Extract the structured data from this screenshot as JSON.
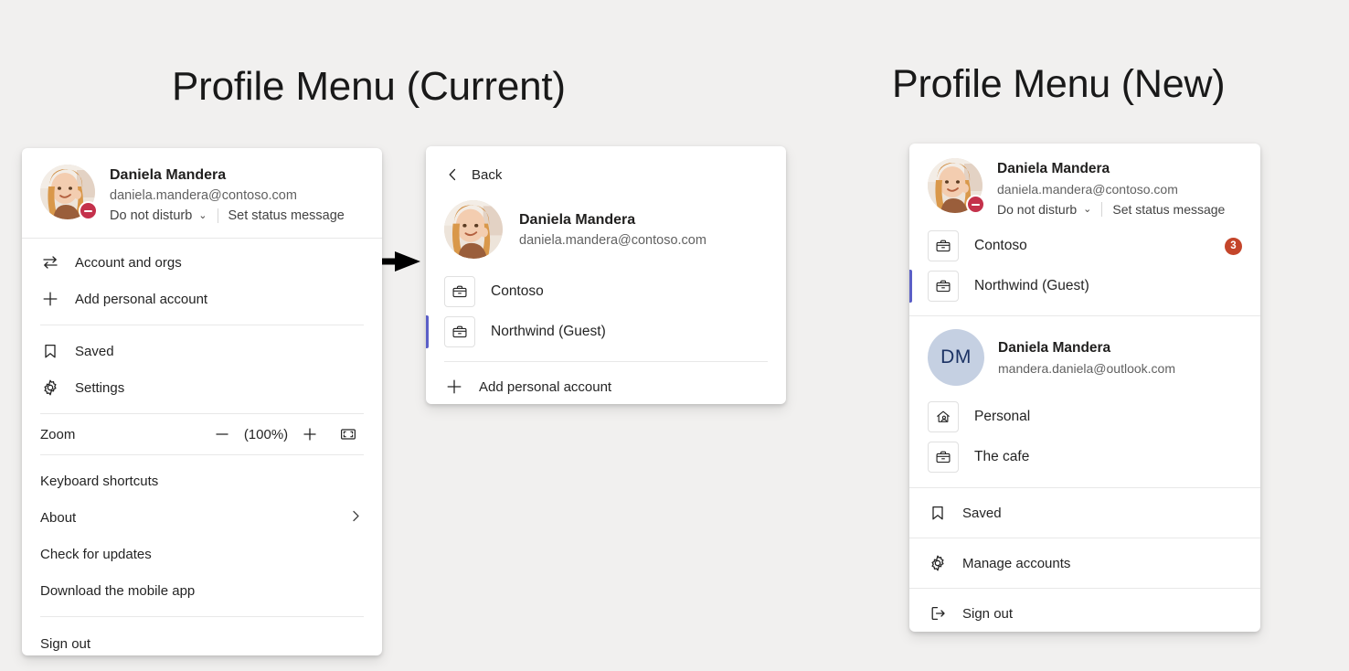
{
  "headings": {
    "current": "Profile Menu (Current)",
    "new": "Profile Menu (New)"
  },
  "colors": {
    "page_background": "#F1F0EF",
    "panel_background": "#FFFFFF",
    "accent_selected": "#5B5FC7",
    "badge_red": "#C4452A",
    "presence_dnd": "#C4314B",
    "initials_avatar_bg": "#C5D0E2",
    "initials_avatar_text": "#1B3264",
    "text_primary": "#242424",
    "text_secondary": "#616161",
    "divider": "#E8E8E8"
  },
  "current_menu": {
    "profile": {
      "name": "Daniela Mandera",
      "email": "daniela.mandera@contoso.com",
      "status": "Do not disturb",
      "status_chevron": "⌄",
      "set_status_label": "Set status message",
      "presence_state": "do-not-disturb",
      "avatar_type": "photo"
    },
    "items": [
      {
        "label": "Account and orgs",
        "icon": "switch-accounts-icon"
      },
      {
        "label": "Add personal account",
        "icon": "plus-icon"
      },
      {
        "label": "Saved",
        "icon": "bookmark-icon"
      },
      {
        "label": "Settings",
        "icon": "gear-icon"
      }
    ],
    "zoom": {
      "label": "Zoom",
      "decrease_icon": "minus-icon",
      "value": "(100%)",
      "increase_icon": "plus-icon",
      "fullscreen_icon": "fullscreen-icon"
    },
    "footer_items": [
      {
        "label": "Keyboard shortcuts",
        "submenu": false
      },
      {
        "label": "About",
        "submenu": true
      },
      {
        "label": "Check for updates",
        "submenu": false
      },
      {
        "label": "Download the mobile app",
        "submenu": false
      }
    ],
    "sign_out": "Sign out"
  },
  "account_switcher": {
    "back_label": "Back",
    "back_icon": "chevron-left-icon",
    "profile": {
      "name": "Daniela Mandera",
      "email": "daniela.mandera@contoso.com",
      "avatar_type": "photo"
    },
    "orgs": [
      {
        "label": "Contoso",
        "icon": "briefcase-icon",
        "selected": false,
        "badge": null
      },
      {
        "label": "Northwind (Guest)",
        "icon": "briefcase-icon",
        "selected": true,
        "badge": null
      }
    ],
    "add_account": {
      "label": "Add personal account",
      "icon": "plus-icon"
    }
  },
  "new_menu": {
    "work_account": {
      "name": "Daniela Mandera",
      "email": "daniela.mandera@contoso.com",
      "status": "Do not disturb",
      "status_chevron": "⌄",
      "set_status_label": "Set status message",
      "presence_state": "do-not-disturb",
      "avatar_type": "photo"
    },
    "work_orgs": [
      {
        "label": "Contoso",
        "icon": "briefcase-icon",
        "selected": false,
        "badge": "3"
      },
      {
        "label": "Northwind (Guest)",
        "icon": "briefcase-icon",
        "selected": true,
        "badge": null
      }
    ],
    "personal_account": {
      "initials": "DM",
      "name": "Daniela Mandera",
      "email": "mandera.daniela@outlook.com",
      "avatar_type": "initials"
    },
    "personal_orgs": [
      {
        "label": "Personal",
        "icon": "home-person-icon",
        "selected": false,
        "badge": null
      },
      {
        "label": "The cafe",
        "icon": "briefcase-icon",
        "selected": false,
        "badge": null
      }
    ],
    "actions": [
      {
        "label": "Saved",
        "icon": "bookmark-icon"
      },
      {
        "label": "Manage accounts",
        "icon": "gear-icon"
      },
      {
        "label": "Sign out",
        "icon": "sign-out-icon"
      }
    ]
  }
}
